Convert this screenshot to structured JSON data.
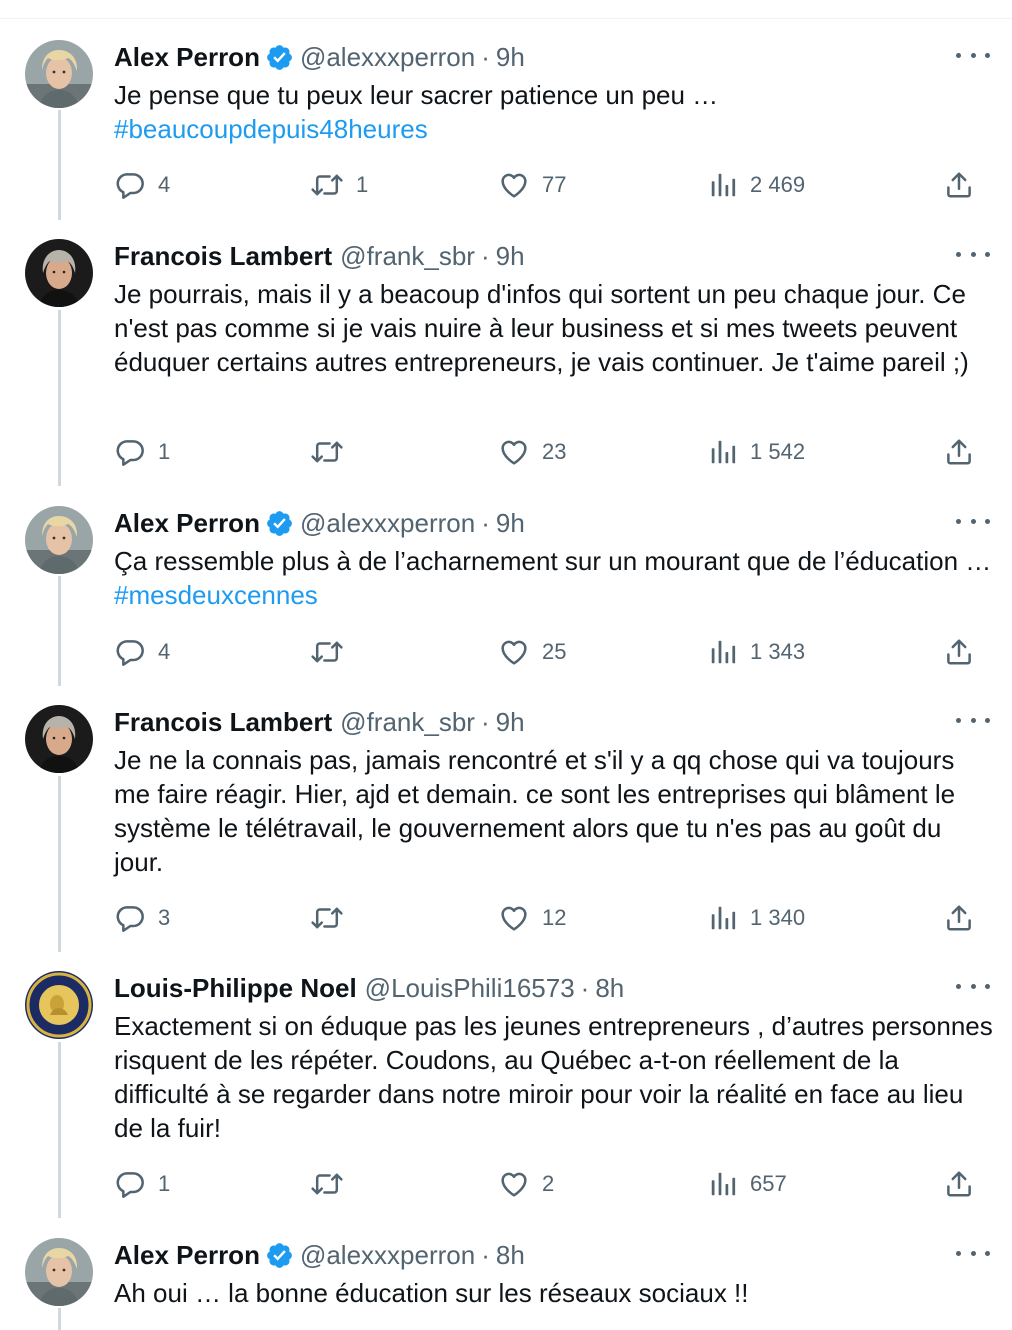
{
  "tweets": [
    {
      "name": "Alex Perron",
      "verified": true,
      "handle": "@alexxxperron",
      "time": "9h",
      "text_plain": "Je pense que tu peux leur sacrer patience un peu …",
      "hashtag": "#beaucoupdepuis48heures",
      "replies": "4",
      "retweets": "1",
      "likes": "77",
      "views": "2 469",
      "avatar": "blonde-man-avatar"
    },
    {
      "name": "Francois Lambert",
      "verified": false,
      "handle": "@frank_sbr",
      "time": "9h",
      "text_plain": "Je pourrais, mais il y a beacoup d'infos qui sortent un peu chaque jour. Ce n'est pas comme si je vais nuire à leur business et si mes tweets peuvent éduquer certains autres entrepreneurs, je vais continuer. Je t'aime pareil ;)",
      "hashtag": "",
      "replies": "1",
      "retweets": "",
      "likes": "23",
      "views": "1 542",
      "avatar": "grey-hair-man-avatar"
    },
    {
      "name": "Alex Perron",
      "verified": true,
      "handle": "@alexxxperron",
      "time": "9h",
      "text_plain": "Ça ressemble plus à de l’acharnement sur un mourant que de l’éducation …",
      "hashtag": "#mesdeuxcennes",
      "replies": "4",
      "retweets": "",
      "likes": "25",
      "views": "1 343",
      "avatar": "blonde-man-avatar"
    },
    {
      "name": "Francois Lambert",
      "verified": false,
      "handle": "@frank_sbr",
      "time": "9h",
      "text_plain": "Je ne la connais pas, jamais rencontré et s'il y a qq chose qui va toujours me faire réagir. Hier, ajd et demain. ce sont les entreprises qui blâment le système le télétravail, le gouvernement alors que tu n'es pas au goût du jour.",
      "hashtag": "",
      "replies": "3",
      "retweets": "",
      "likes": "12",
      "views": "1 340",
      "avatar": "grey-hair-man-avatar"
    },
    {
      "name": "Louis-Philippe Noel",
      "verified": false,
      "handle": "@LouisPhili16573",
      "time": "8h",
      "text_plain": "Exactement si on éduque pas les jeunes entrepreneurs , d’autres personnes risquent de les répéter. Coudons, au Québec a-t-on réellement de la difficulté à se regarder dans notre miroir pour voir la réalité en face au lieu de la fuir!",
      "hashtag": "",
      "replies": "1",
      "retweets": "",
      "likes": "2",
      "views": "657",
      "avatar": "seal-emblem-avatar"
    },
    {
      "name": "Alex Perron",
      "verified": true,
      "handle": "@alexxxperron",
      "time": "8h",
      "text_plain": "Ah oui … la bonne éducation sur les réseaux sociaux !!",
      "hashtag": "",
      "avatar": "blonde-man-avatar"
    }
  ],
  "icons": {
    "reply": "reply-icon",
    "retweet": "retweet-icon",
    "like": "heart-icon",
    "views": "views-icon",
    "share": "share-icon",
    "more": "more-icon",
    "verified": "verified-badge-icon"
  },
  "colors": {
    "hashtag": "#1d9bf0",
    "verified": "#1d9bf0",
    "secondary": "#536471",
    "thread": "#cfd9de"
  }
}
